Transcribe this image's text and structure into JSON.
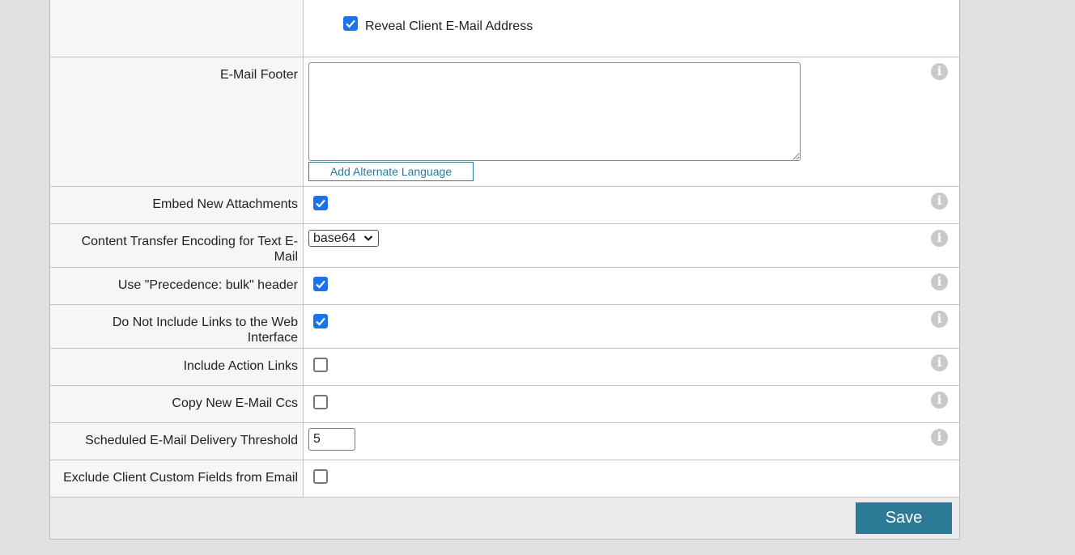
{
  "reveal": {
    "label": "Reveal Client E-Mail Address",
    "checked": true
  },
  "footer": {
    "label": "E-Mail Footer",
    "value": "",
    "alt_language_button": "Add Alternate Language"
  },
  "settings": {
    "embed_attachments": {
      "label": "Embed New Attachments",
      "checked": true
    },
    "encoding": {
      "label_line1": "Content Transfer Encoding for Text E-",
      "label_line2": "Mail",
      "selected": "base64"
    },
    "precedence": {
      "label": "Use \"Precedence: bulk\" header",
      "checked": true
    },
    "no_links": {
      "label_line1": "Do Not Include Links to the Web",
      "label_line2": "Interface",
      "checked": true
    },
    "action_links": {
      "label": "Include Action Links",
      "checked": false
    },
    "copy_ccs": {
      "label": "Copy New E-Mail Ccs",
      "checked": false
    },
    "delivery_threshold": {
      "label": "Scheduled E-Mail Delivery Threshold",
      "value": "5"
    },
    "exclude_custom_fields": {
      "label": "Exclude Client Custom Fields from Email",
      "checked": false
    }
  },
  "actions": {
    "save_label": "Save"
  },
  "icons": {
    "info": "info-icon",
    "check": "checkmark-icon",
    "chevron": "chevron-down-icon"
  },
  "colors": {
    "accent": "#2b7b97",
    "checkbox": "#1a73e8",
    "page_bg": "#dfe0e2",
    "label_bg": "#f6f6f6"
  }
}
